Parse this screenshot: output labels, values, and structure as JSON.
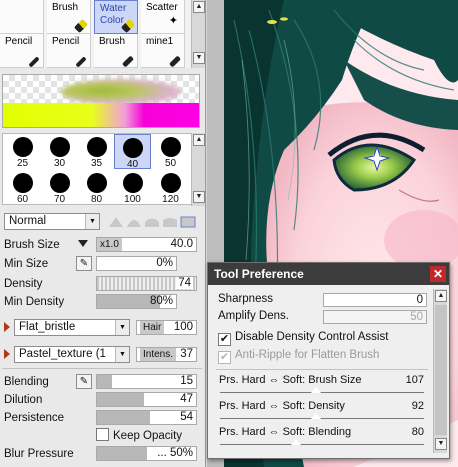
{
  "tools": {
    "row1": [
      {
        "label": "",
        "icon": "blank"
      },
      {
        "label": "Brush",
        "icon": "brush-icon"
      },
      {
        "label": "Water\nColor",
        "icon": "watercolor-icon",
        "selected": true
      },
      {
        "label": "Scatter",
        "icon": "scatter-icon"
      }
    ],
    "row2": [
      {
        "label": "Pencil",
        "icon": "pencil-icon"
      },
      {
        "label": "Pencil",
        "icon": "pencil-icon"
      },
      {
        "label": "Brush",
        "icon": "brush-icon"
      },
      {
        "label": "mine1",
        "icon": "brush-icon"
      }
    ]
  },
  "brush_sizes": {
    "row1": [
      "25",
      "30",
      "35",
      "40",
      "50"
    ],
    "row2": [
      "60",
      "70",
      "80",
      "100",
      "120"
    ],
    "selected": "40"
  },
  "blend_mode": "Normal",
  "params": {
    "brush_size_label": "Brush Size",
    "brush_size_mult": "x1.0",
    "brush_size_value": "40.0",
    "min_size_label": "Min Size",
    "min_size_value": "0%",
    "min_size_fill": 0,
    "density_label": "Density",
    "density_value": "74",
    "min_density_label": "Min Density",
    "min_density_value": "80%",
    "min_density_fill": 0.8
  },
  "brush_shape": {
    "shape_name": "Flat_bristle",
    "shape_tag": "Hair",
    "shape_value": "100",
    "texture_name": "Pastel_texture (1",
    "texture_tag": "Intens.",
    "texture_value": "37"
  },
  "mixing": {
    "blending_label": "Blending",
    "blending_value": "15",
    "blending_fill": 0.15,
    "dilution_label": "Dilution",
    "dilution_value": "47",
    "dilution_fill": 0.47,
    "persistence_label": "Persistence",
    "persistence_value": "54",
    "persistence_fill": 0.54,
    "keep_opacity_label": "Keep Opacity",
    "blur_pressure_label": "Blur Pressure",
    "blur_pressure_value": "... 50%",
    "blur_pressure_fill": 0.5
  },
  "dialog": {
    "title": "Tool Preference",
    "sharpness_label": "Sharpness",
    "sharpness_value": "0",
    "amplify_label": "Amplify Dens.",
    "amplify_value": "50",
    "disable_density_label": "Disable Density Control Assist",
    "anti_ripple_label": "Anti-Ripple for Flatten Brush",
    "curves": [
      {
        "label": "Prs. Hard ⇔ Soft: Brush Size",
        "value": "107",
        "knob": 0.48
      },
      {
        "label": "Prs. Hard ⇔ Soft: Density",
        "value": "92",
        "knob": 0.48
      },
      {
        "label": "Prs. Hard ⇔ Soft: Blending",
        "value": "80",
        "knob": 0.38
      }
    ]
  },
  "colors": {
    "accent": "#6b7fcf",
    "close": "#c0282c",
    "hair": "#0f4a44",
    "skin": "#fde3e6"
  }
}
